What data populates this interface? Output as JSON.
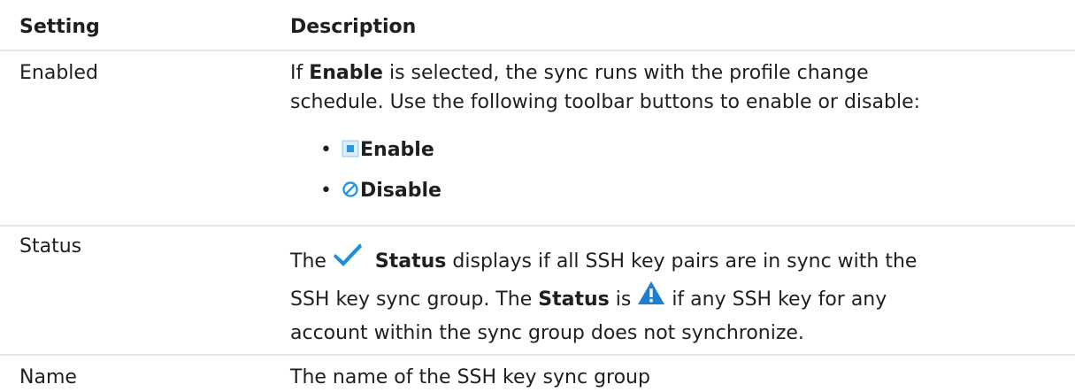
{
  "table": {
    "headers": {
      "setting": "Setting",
      "description": "Description"
    },
    "rows": [
      {
        "setting": "Enabled",
        "desc_prefix": "If ",
        "desc_bold": "Enable",
        "desc_line1_rest": " is selected, the sync runs with the profile change",
        "desc_line2": "schedule. Use the following toolbar buttons to enable or disable:",
        "bullets": [
          {
            "icon": "enable-icon",
            "label": "Enable"
          },
          {
            "icon": "disable-icon",
            "label": "Disable"
          }
        ]
      },
      {
        "setting": "Status",
        "l1_pre": "The ",
        "l1_bold": "Status",
        "l1_post": " displays if all SSH key pairs are in sync with the",
        "l2_pre": "SSH key sync group. The ",
        "l2_bold": "Status",
        "l2_mid": " is ",
        "l2_post": " if any SSH key for any",
        "l3": "account within the sync group does not synchronize.",
        "icons": [
          "checkmark-icon",
          "warning-icon"
        ]
      },
      {
        "setting": "Name",
        "description": "The name of the SSH key sync group"
      }
    ]
  },
  "colors": {
    "check": "#1e8fd8",
    "warning": "#1a7fd0",
    "enable": "#2a95e0",
    "rule": "#e6e6e6"
  }
}
